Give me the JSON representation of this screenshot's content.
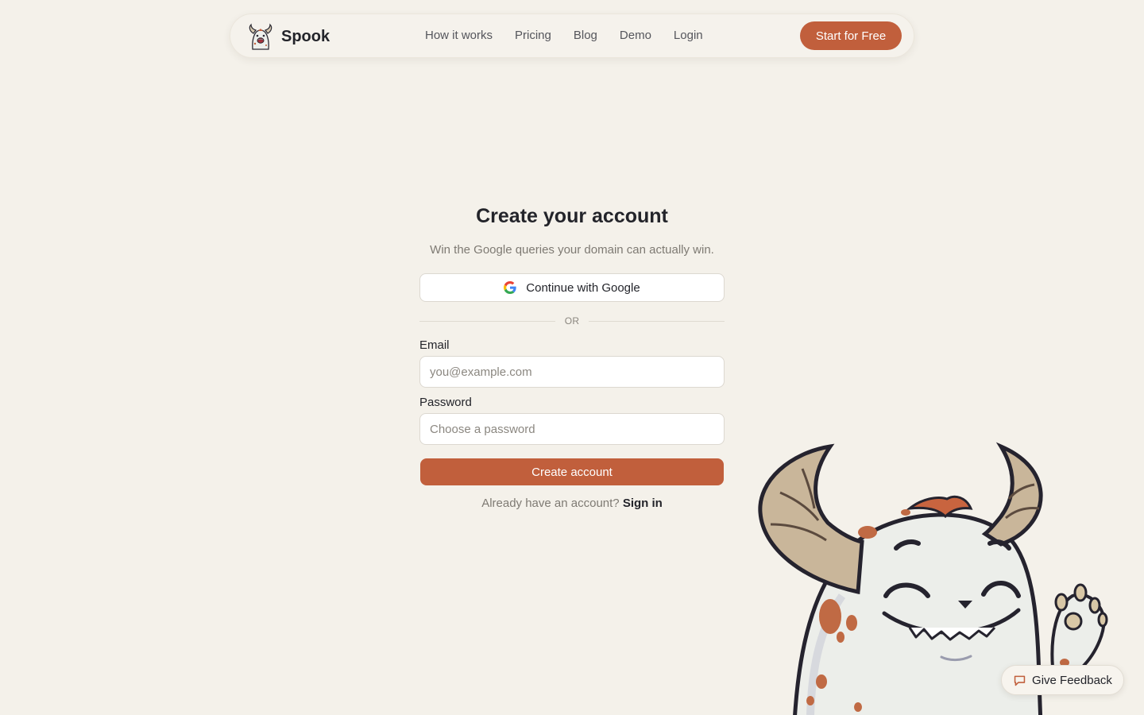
{
  "nav": {
    "brand": "Spook",
    "links": [
      "How it works",
      "Pricing",
      "Blog",
      "Demo",
      "Login"
    ],
    "cta": "Start for Free"
  },
  "form": {
    "title": "Create your account",
    "subtitle": "Win the Google queries your domain can actually win.",
    "google_button": "Continue with Google",
    "divider": "OR",
    "email": {
      "label": "Email",
      "placeholder": "you@example.com",
      "value": ""
    },
    "password": {
      "label": "Password",
      "placeholder": "Choose a password",
      "value": ""
    },
    "submit": "Create account",
    "signin_prompt": "Already have an account?",
    "signin_link": "Sign in"
  },
  "feedback": {
    "label": "Give Feedback"
  },
  "colors": {
    "background": "#f4f1ea",
    "accent": "#c15f3c",
    "text": "#23242a",
    "muted": "#7e7a73"
  },
  "icons": {
    "logo": "spook-monster-logo-icon",
    "google": "google-g-icon",
    "feedback": "chat-bubble-icon"
  }
}
